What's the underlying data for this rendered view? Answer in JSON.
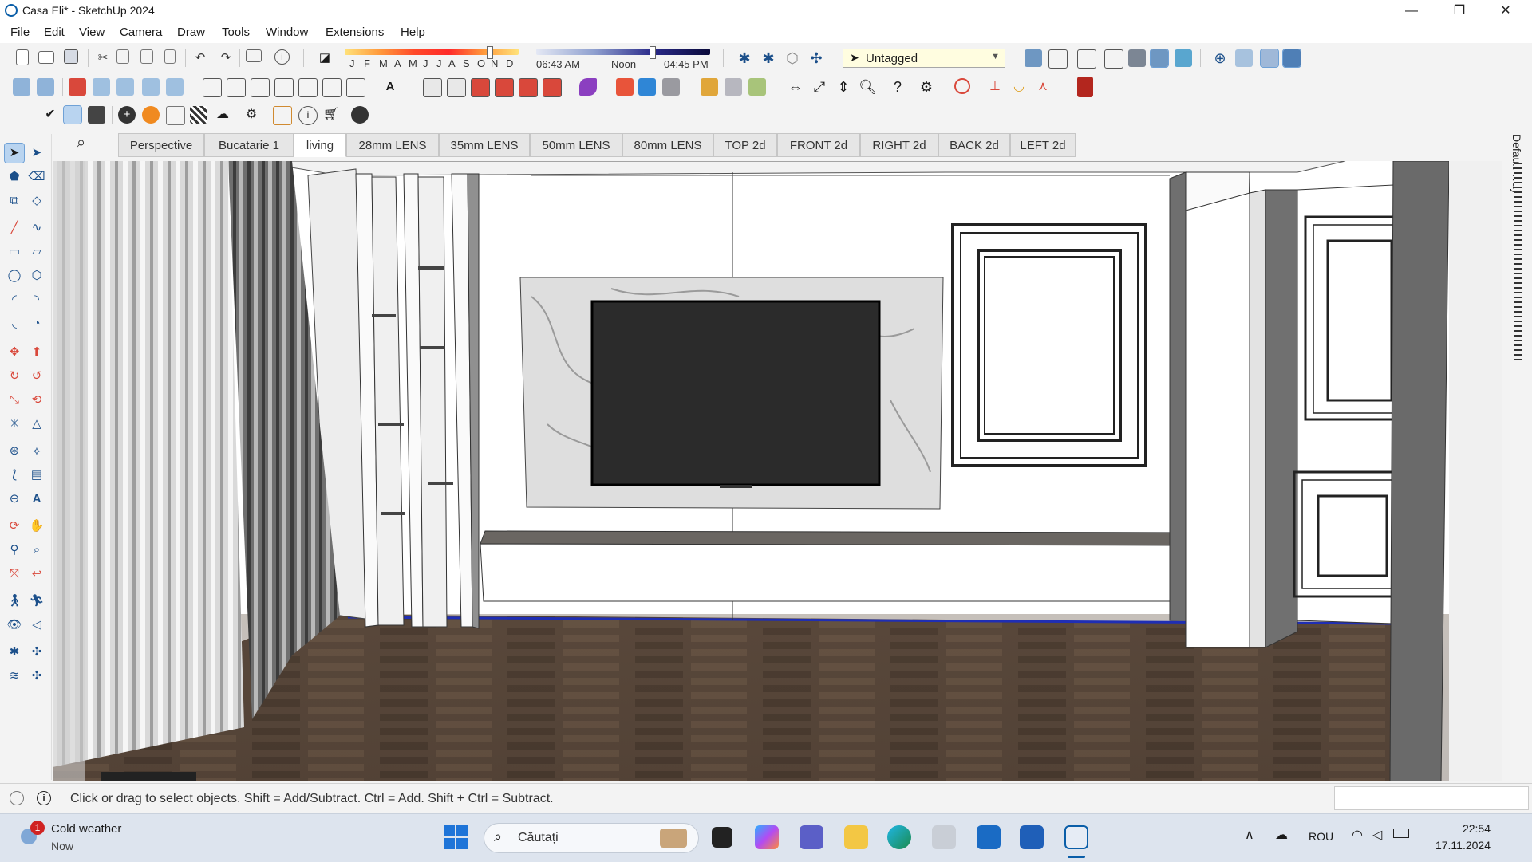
{
  "window": {
    "title": "Casa Eli* - SketchUp 2024",
    "min": "—",
    "max": "❐",
    "close": "✕"
  },
  "menu": [
    "File",
    "Edit",
    "View",
    "Camera",
    "Draw",
    "Tools",
    "Window",
    "Extensions",
    "Help"
  ],
  "shadows": {
    "months": [
      "J",
      "F",
      "M",
      "A",
      "M",
      "J",
      "J",
      "A",
      "S",
      "O",
      "N",
      "D"
    ],
    "sunrise": "06:43 AM",
    "noon": "Noon",
    "sunset": "04:45 PM"
  },
  "tag_dropdown": {
    "value": "Untagged"
  },
  "scene_tabs": [
    "Perspective",
    "Bucatarie 1",
    "living",
    "28mm LENS",
    "35mm LENS",
    "50mm LENS",
    "80mm LENS",
    "TOP 2d",
    "FRONT 2d",
    "RIGHT 2d",
    "BACK 2d",
    "LEFT 2d"
  ],
  "active_tab": "living",
  "tray": {
    "label": "Default Tray"
  },
  "status": {
    "message": "Click or drag to select objects. Shift = Add/Subtract. Ctrl = Add. Shift + Ctrl = Subtract."
  },
  "taskbar": {
    "weather_title": "Cold weather",
    "weather_sub": "Now",
    "weather_badge": "1",
    "search_placeholder": "Căutați",
    "lang": "ROU",
    "time": "22:54",
    "date": "17.11.2024"
  },
  "colors": {
    "accent": "#0a5ea8",
    "selected": "#b9d4f0",
    "floor": "#5a4a3c",
    "tv": "#2b2b2b"
  }
}
